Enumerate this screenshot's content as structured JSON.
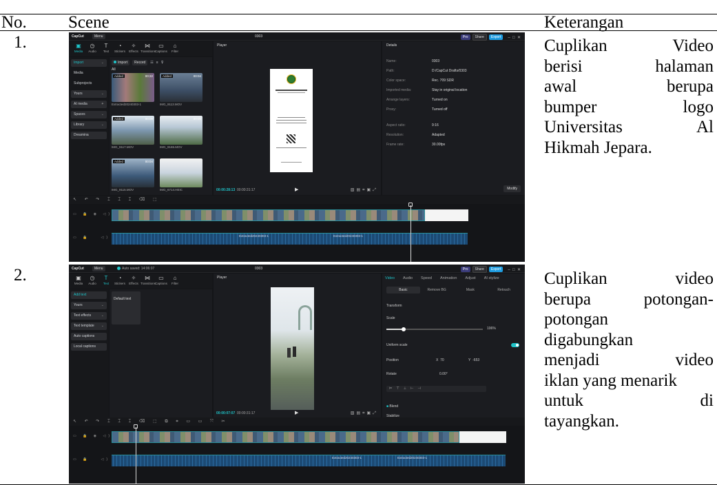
{
  "table": {
    "headers": {
      "no": "No.",
      "scene": "Scene",
      "keterangan": "Keterangan"
    },
    "rows": [
      {
        "no": "1.",
        "desc_lines": [
          "Cuplikan Video",
          "berisi halaman",
          "awal berupa",
          "bumper logo",
          "Universitas Al",
          "Hikmah Jepara."
        ]
      },
      {
        "no": "2.",
        "desc_lines": [
          "Cuplikan video",
          "berupa potongan-",
          "potongan",
          "digabungkan",
          "menjadi video",
          "iklan yang menarik",
          "untuk di",
          "tayangkan."
        ]
      }
    ]
  },
  "app": {
    "logo": "CapCut",
    "menu": "Menu",
    "project_title": "0303",
    "autosave": "Auto saved: 14:06:07",
    "pro": "Pro",
    "share": "Share",
    "export": "Export"
  },
  "shot1": {
    "tools": [
      "Media",
      "Audio",
      "Text",
      "Stickers",
      "Effects",
      "Transitions",
      "Captions",
      "Filter"
    ],
    "nav": [
      "Import",
      "Media",
      "Subprojects",
      "Yours",
      "AI media",
      "Spaces",
      "Library",
      "Dreamina"
    ],
    "import_btn": "Import",
    "record_btn": "Record",
    "all_label": "All",
    "thumbs": [
      {
        "tag": "Added",
        "dur": "00:22",
        "label": "Extracted20240303-1"
      },
      {
        "tag": "Added",
        "dur": "00:04",
        "label": "IMG_9113.MOV"
      },
      {
        "tag": "Added",
        "dur": "00:09",
        "label": "IMG_9117.MOV"
      },
      {
        "tag": "",
        "dur": "00:05",
        "label": "IMG_9165.MOV"
      },
      {
        "tag": "Added",
        "dur": "00:04",
        "label": "IMG_9115.MOV"
      },
      {
        "tag": "",
        "dur": "",
        "label": "IMG_6714.HEIC"
      }
    ],
    "player_title": "Player",
    "time_current": "00:00:28:13",
    "time_total": "00:00:31:17",
    "details_title": "Details",
    "details": [
      {
        "k": "Name:",
        "v": "0303"
      },
      {
        "k": "Path:",
        "v": "D:/CapCut Drafts/0303"
      },
      {
        "k": "Color space:",
        "v": "Rec. 709 SDR"
      },
      {
        "k": "Imported media:",
        "v": "Stay in original location"
      },
      {
        "k": "Arrange layers:",
        "v": "Turned on"
      },
      {
        "k": "Proxy:",
        "v": "Turned off"
      },
      {
        "k": "Aspect ratio:",
        "v": "9:16"
      },
      {
        "k": "Resolution:",
        "v": "Adapted"
      },
      {
        "k": "Frame rate:",
        "v": "30.00fps"
      }
    ],
    "modify": "Modify",
    "audio_labels": [
      "Extracted20240303-1",
      "Extracted20240303-1"
    ]
  },
  "shot2": {
    "nav": [
      "Add text",
      "Yours",
      "Text effects",
      "Text template",
      "Auto captions",
      "Local captions"
    ],
    "default_text": "Default text",
    "time_current": "00:00:07:07",
    "time_total": "00:00:31:17",
    "tabs": [
      "Video",
      "Audio",
      "Speed",
      "Animation",
      "Adjust",
      "AI stylize"
    ],
    "subtabs": [
      "Basic",
      "Remove BG",
      "Mask",
      "Retouch"
    ],
    "transform": "Transform",
    "scale": "Scale",
    "scale_val": "106%",
    "uniform_scale": "Uniform scale",
    "position": "Position",
    "pos_x": "70",
    "pos_y": "-653",
    "rotate": "Rotate",
    "rotate_val": "0.00°",
    "blend": "Blend",
    "stabilize": "Stabilize",
    "audio_labels": [
      "Extracted20240303-1",
      "Extracted20240303-1"
    ]
  }
}
